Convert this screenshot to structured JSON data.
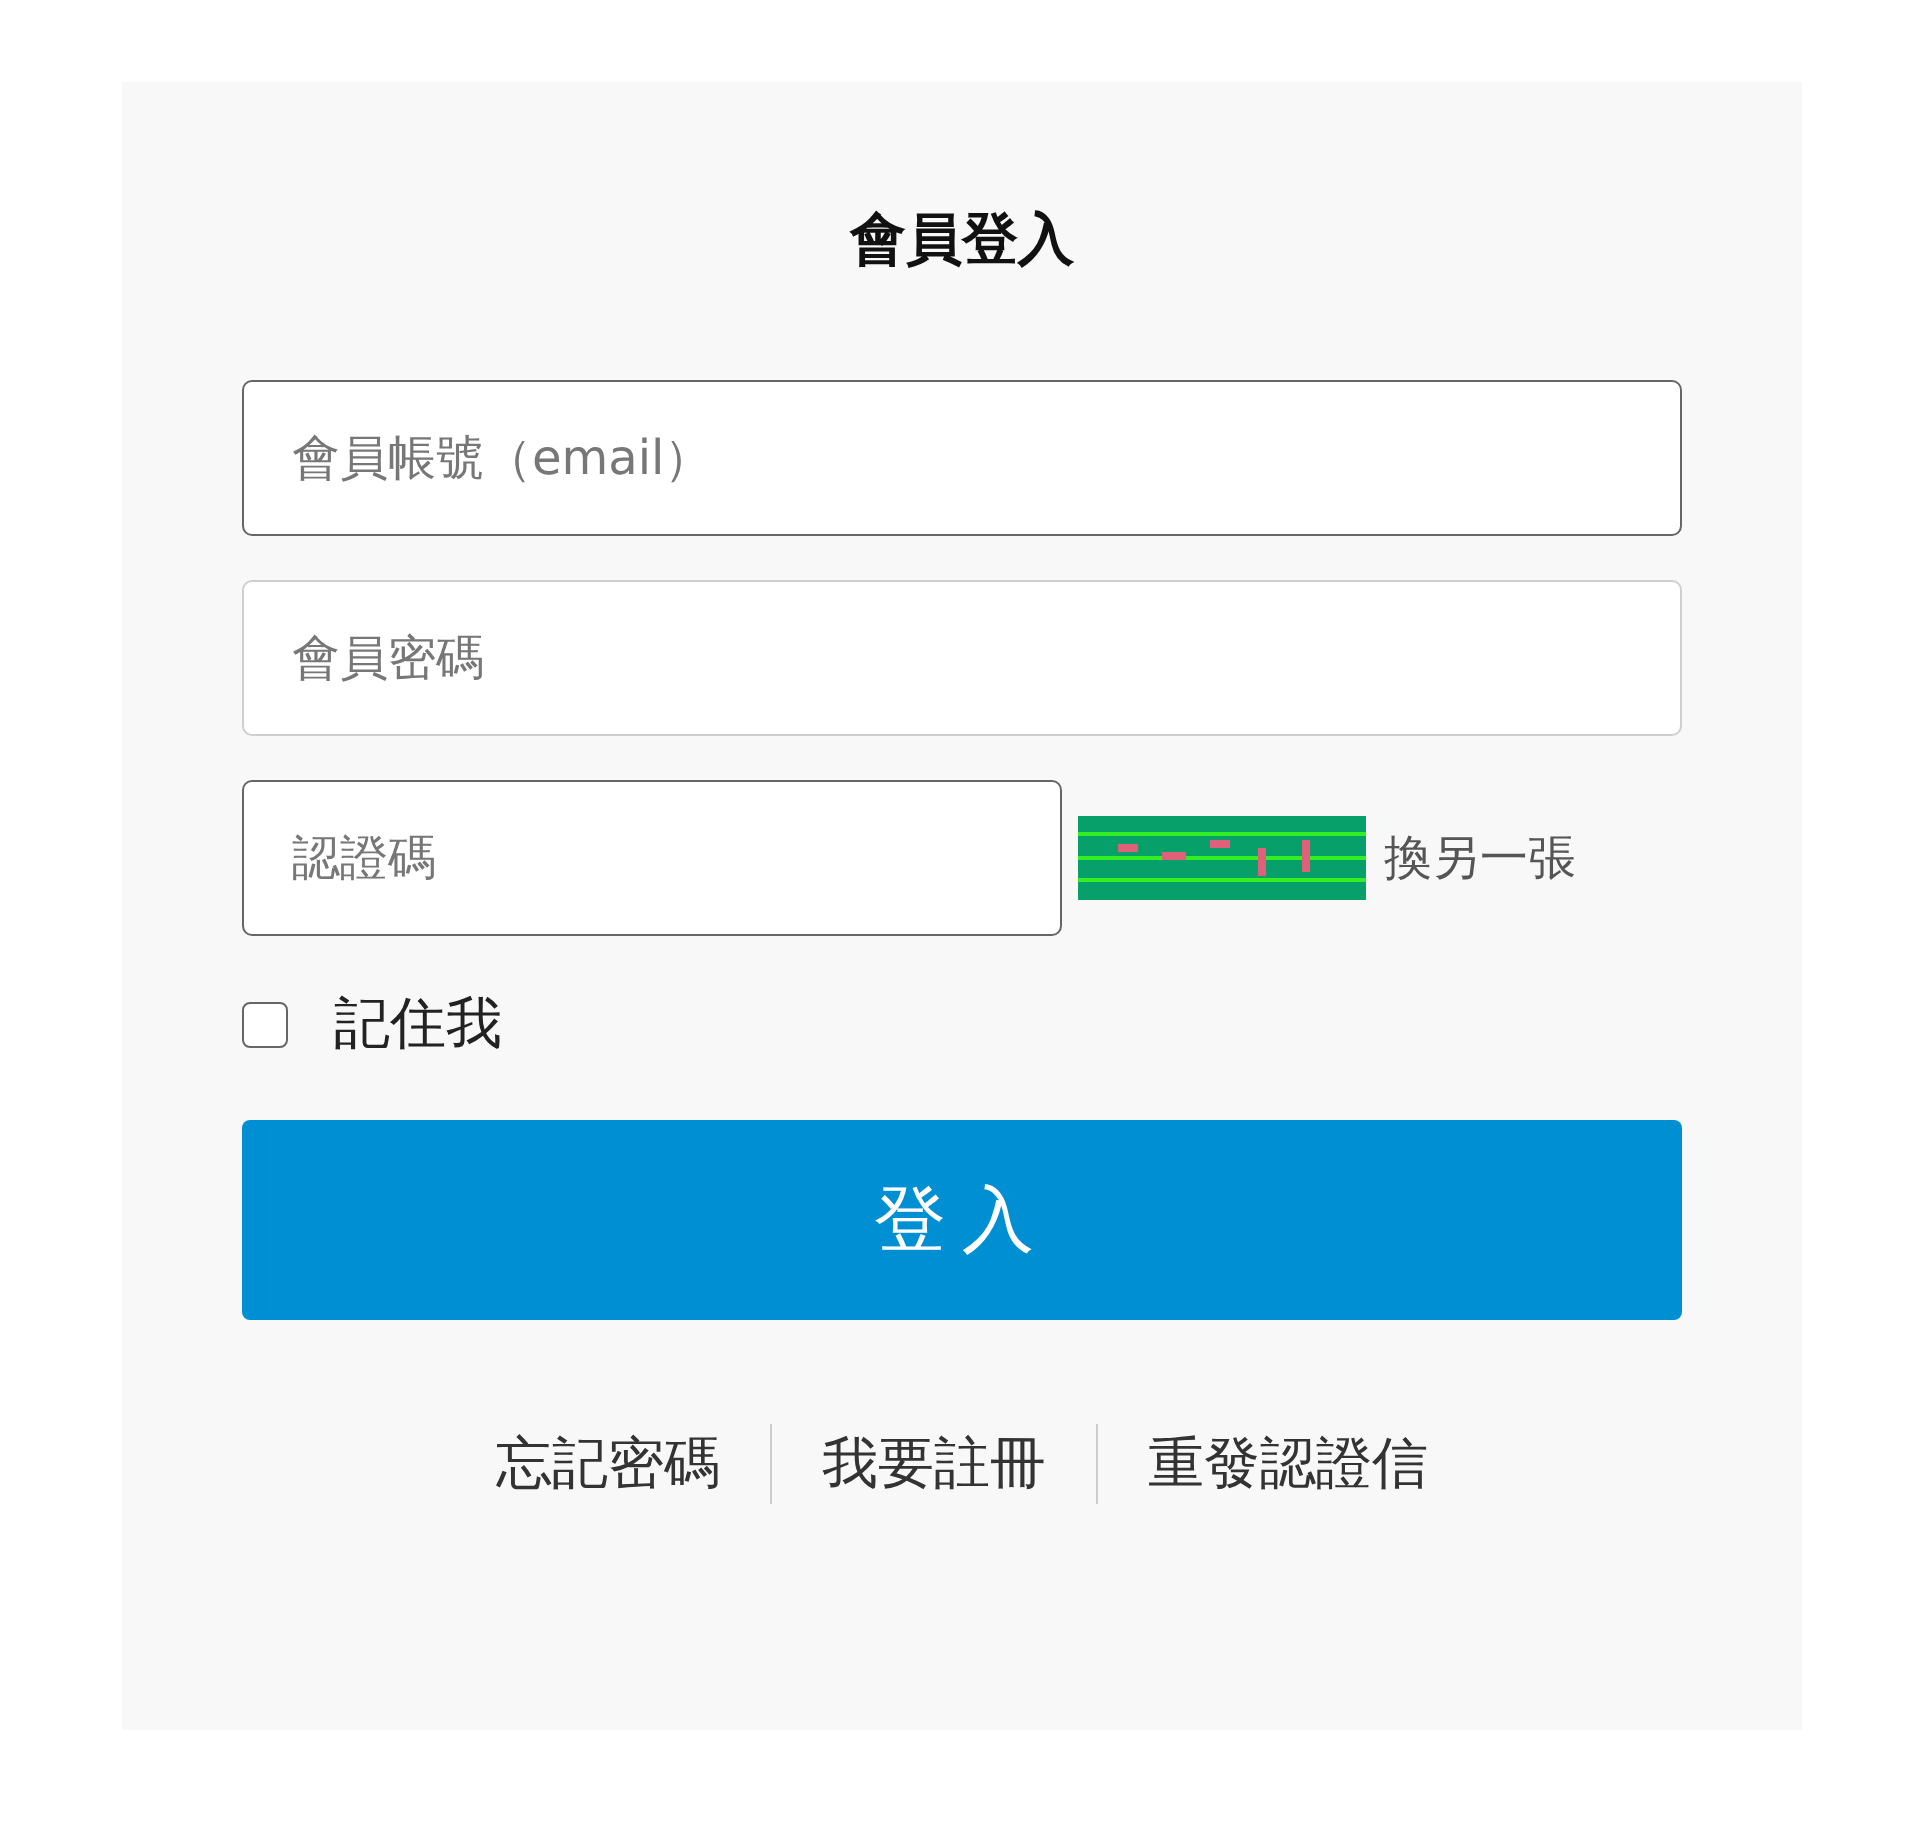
{
  "title": "會員登入",
  "fields": [
    {
      "placeholder": "會員帳號（email）",
      "highlighted": true
    },
    {
      "placeholder": "會員密碼",
      "highlighted": false
    }
  ],
  "captcha": {
    "field": {
      "placeholder": "認證碼",
      "highlighted": true
    },
    "refresh_link": "換另一張"
  },
  "remember": {
    "label": "記住我",
    "checked": false
  },
  "submit": "登入",
  "links": [
    "忘記密碼",
    "我要註冊",
    "重發認證信"
  ]
}
